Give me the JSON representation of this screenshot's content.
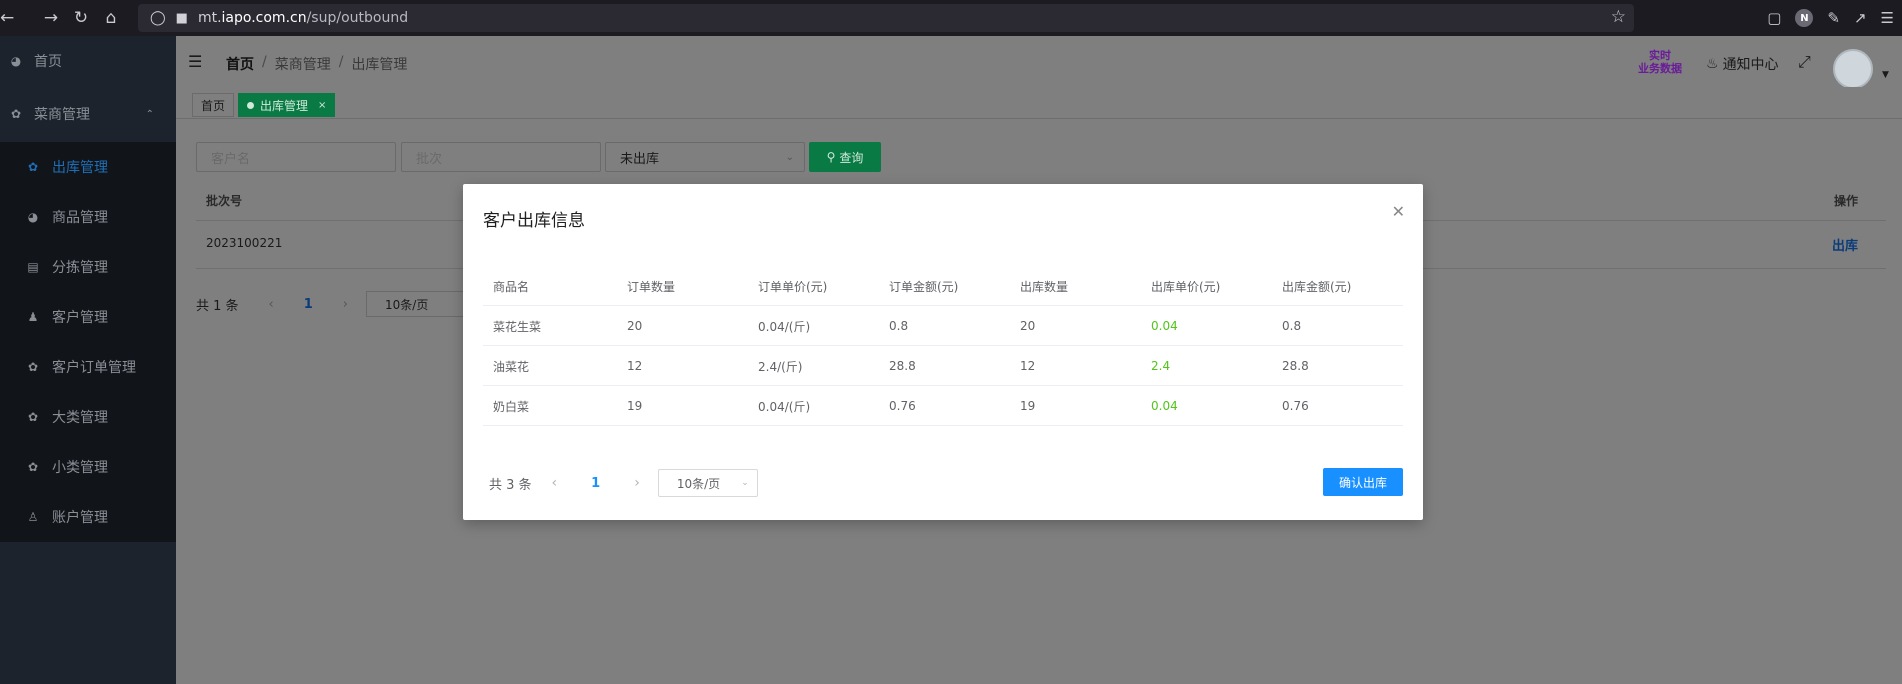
{
  "browser": {
    "url_prefix": "mt.",
    "url_domain": "iapo.com.cn",
    "url_path": "/sup/outbound",
    "profile_initial": "N"
  },
  "sidebar": {
    "home": "首页",
    "group": "菜商管理",
    "items": [
      {
        "label": "出库管理",
        "icon": "clover-icon",
        "active": true
      },
      {
        "label": "商品管理",
        "icon": "dashboard-icon",
        "active": false
      },
      {
        "label": "分拣管理",
        "icon": "document-icon",
        "active": false
      },
      {
        "label": "客户管理",
        "icon": "users-icon",
        "active": false
      },
      {
        "label": "客户订单管理",
        "icon": "clover-icon",
        "active": false
      },
      {
        "label": "大类管理",
        "icon": "clover-icon",
        "active": false
      },
      {
        "label": "小类管理",
        "icon": "clover-icon",
        "active": false
      },
      {
        "label": "账户管理",
        "icon": "person-icon",
        "active": false
      }
    ]
  },
  "topbar": {
    "breadcrumb": [
      "首页",
      "菜商管理",
      "出库管理"
    ],
    "realtime_line1": "实时",
    "realtime_line2": "业务数据",
    "notify": "通知中心"
  },
  "tags": {
    "home": "首页",
    "active": "出库管理"
  },
  "filters": {
    "customer_placeholder": "客户名",
    "batch_placeholder": "批次",
    "status_value": "未出库",
    "query_label": "查询"
  },
  "bg_table": {
    "col_batch": "批次号",
    "col_op": "操作",
    "row_batch": "2023100221",
    "row_op": "出库",
    "total": "共 1 条",
    "page": "1",
    "page_size": "10条/页"
  },
  "modal": {
    "title": "客户出库信息",
    "columns": [
      "商品名",
      "订单数量",
      "订单单价(元)",
      "订单金额(元)",
      "出库数量",
      "出库单价(元)",
      "出库金额(元)"
    ],
    "rows": [
      [
        "菜花生菜",
        "20",
        "0.04/(斤)",
        "0.8",
        "20",
        "0.04",
        "0.8"
      ],
      [
        "油菜花",
        "12",
        "2.4/(斤)",
        "28.8",
        "12",
        "2.4",
        "28.8"
      ],
      [
        "奶白菜",
        "19",
        "0.04/(斤)",
        "0.76",
        "19",
        "0.04",
        "0.76"
      ]
    ],
    "total": "共 3 条",
    "page": "1",
    "page_size": "10条/页",
    "confirm_label": "确认出库",
    "accent_color": "#1890ff",
    "price_color": "#52c41a"
  }
}
